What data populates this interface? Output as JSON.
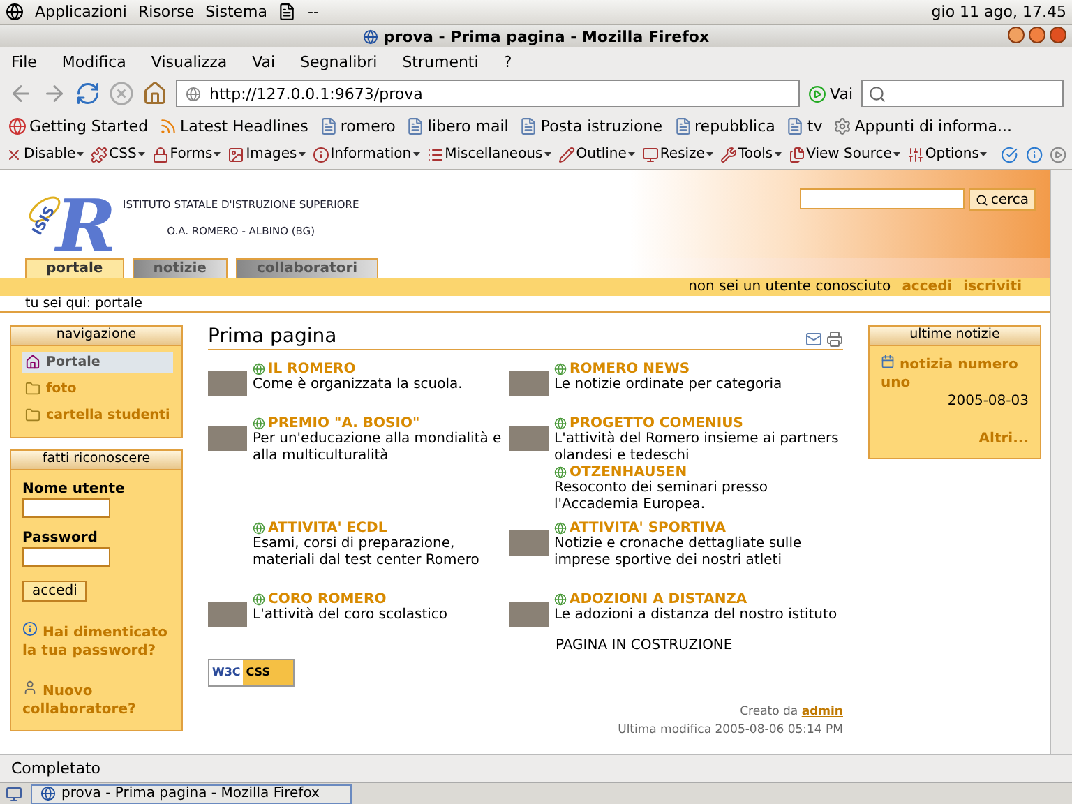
{
  "top_panel": {
    "menus": [
      "Applicazioni",
      "Risorse",
      "Sistema"
    ],
    "extra": "--",
    "clock": "gio 11 ago, 17.45"
  },
  "window": {
    "title": "prova - Prima pagina - Mozilla Firefox"
  },
  "menu_bar": [
    "File",
    "Modifica",
    "Visualizza",
    "Vai",
    "Segnalibri",
    "Strumenti",
    "?"
  ],
  "nav_toolbar": {
    "url": "http://127.0.0.1:9673/prova",
    "go": "Vai"
  },
  "bookmarks": [
    {
      "label": "Getting Started",
      "kind": "firefox"
    },
    {
      "label": "Latest Headlines",
      "kind": "feed"
    },
    {
      "label": "romero",
      "kind": "page"
    },
    {
      "label": "libero mail",
      "kind": "page"
    },
    {
      "label": "Posta istruzione",
      "kind": "page"
    },
    {
      "label": "repubblica",
      "kind": "page"
    },
    {
      "label": "tv",
      "kind": "page"
    },
    {
      "label": "Appunti di informa...",
      "kind": "gear"
    }
  ],
  "dev_toolbar": [
    "Disable",
    "CSS",
    "Forms",
    "Images",
    "Information",
    "Miscellaneous",
    "Outline",
    "Resize",
    "Tools",
    "View Source",
    "Options"
  ],
  "site": {
    "logo_letter": "R",
    "logo_arc": "ISIS",
    "name_line_1": "ISTITUTO STATALE D'ISTRUZIONE SUPERIORE",
    "name_line_2": "O.A. ROMERO - ALBINO (BG)",
    "search_button": "cerca",
    "tabs": [
      {
        "label": "portale",
        "selected": true
      },
      {
        "label": "notizie",
        "selected": false
      },
      {
        "label": "collaboratori",
        "selected": false
      }
    ],
    "user_status": "non sei un utente conosciuto",
    "user_links": [
      "accedi",
      "iscriviti"
    ],
    "breadcrumb": "tu sei qui: portale"
  },
  "navigation": {
    "title": "navigazione",
    "items": [
      {
        "label": "Portale",
        "kind": "home",
        "selected": true
      },
      {
        "label": "foto",
        "kind": "folder",
        "selected": false
      },
      {
        "label": "cartella studenti",
        "kind": "folder",
        "selected": false
      }
    ]
  },
  "login": {
    "title": "fatti riconoscere",
    "username_label": "Nome utente",
    "password_label": "Password",
    "button": "accedi",
    "links": [
      {
        "label": "Hai dimenticato la tua password?",
        "kind": "info"
      },
      {
        "label": "Nuovo collaboratore?",
        "kind": "user"
      }
    ]
  },
  "content": {
    "heading": "Prima pagina",
    "rows": [
      {
        "left": [
          {
            "title": "IL ROMERO",
            "text": "Come è organizzata la scuola.",
            "thumb": true
          }
        ],
        "right": [
          {
            "title": "ROMERO NEWS",
            "text": "Le notizie ordinate per categoria",
            "thumb": true
          }
        ]
      },
      {
        "left": [
          {
            "title": "PREMIO \"A. BOSIO\"",
            "text": "Per un'educazione alla mondialità e alla multiculturalità",
            "thumb": true
          }
        ],
        "right": [
          {
            "title": "PROGETTO COMENIUS",
            "text": "L'attività del Romero insieme ai partners olandesi e tedeschi",
            "thumb": true
          },
          {
            "title": "OTZENHAUSEN",
            "text": "Resoconto dei seminari presso l'Accademia Europea.",
            "thumb": false
          }
        ]
      },
      {
        "left": [
          {
            "title": "ATTIVITA' ECDL",
            "text": "Esami, corsi di preparazione, materiali dal test center Romero",
            "thumb": false
          }
        ],
        "right": [
          {
            "title": "ATTIVITA' SPORTIVA",
            "text": "Notizie e cronache dettagliate sulle imprese sportive dei nostri atleti",
            "thumb": true
          }
        ]
      },
      {
        "left": [
          {
            "title": "CORO ROMERO",
            "text": "L'attività del coro scolastico",
            "thumb": true
          }
        ],
        "right": [
          {
            "title": "ADOZIONI A DISTANZA",
            "text": "Le adozioni a distanza del nostro istituto",
            "thumb": true
          }
        ]
      }
    ],
    "note": "PAGINA IN COSTRUZIONE",
    "badge_left": "W3C",
    "badge_right": "CSS",
    "created_by": "Creato da",
    "author": "admin",
    "modified": "Ultima modifica 2005-08-06 05:14 PM"
  },
  "news": {
    "title": "ultime notizie",
    "items": [
      {
        "title": "notizia numero uno",
        "date": "2005-08-03"
      }
    ],
    "more": "Altri..."
  },
  "status_bar": "Completato",
  "taskbar": {
    "task": "prova - Prima pagina - Mozilla Firefox"
  }
}
